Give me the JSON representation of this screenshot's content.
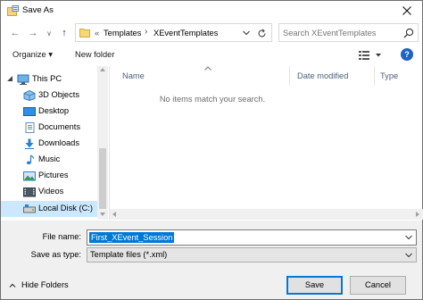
{
  "window": {
    "title": "Save As"
  },
  "toolbar": {
    "back": "←",
    "forward": "→",
    "recent": "∨",
    "up": "↑",
    "breadcrumb": {
      "overflow": "«",
      "items": [
        "Templates",
        "XEventTemplates"
      ],
      "separator": "›"
    },
    "search_placeholder": "Search XEventTemplates"
  },
  "commands": {
    "organize": "Organize ▾",
    "new_folder": "New folder"
  },
  "nav": {
    "items": [
      {
        "label": "This PC",
        "icon": "pc-icon"
      },
      {
        "label": "3D Objects",
        "icon": "3d-objects-icon"
      },
      {
        "label": "Desktop",
        "icon": "desktop-icon"
      },
      {
        "label": "Documents",
        "icon": "documents-icon"
      },
      {
        "label": "Downloads",
        "icon": "downloads-icon"
      },
      {
        "label": "Music",
        "icon": "music-icon"
      },
      {
        "label": "Pictures",
        "icon": "pictures-icon"
      },
      {
        "label": "Videos",
        "icon": "videos-icon"
      },
      {
        "label": "Local Disk (C:)",
        "icon": "drive-icon"
      }
    ]
  },
  "content": {
    "columns": [
      "Name",
      "Date modified",
      "Type"
    ],
    "empty_message": "No items match your search."
  },
  "form": {
    "filename_label": "File name:",
    "filename_value": "First_XEvent_Session",
    "savetype_label": "Save as type:",
    "savetype_value": "Template files (*.xml)"
  },
  "footer": {
    "hide_folders": "Hide Folders",
    "save": "Save",
    "cancel": "Cancel"
  },
  "colors": {
    "accent": "#0078d7",
    "selected_bg": "#cce8ff",
    "help": "#1e63c4"
  }
}
